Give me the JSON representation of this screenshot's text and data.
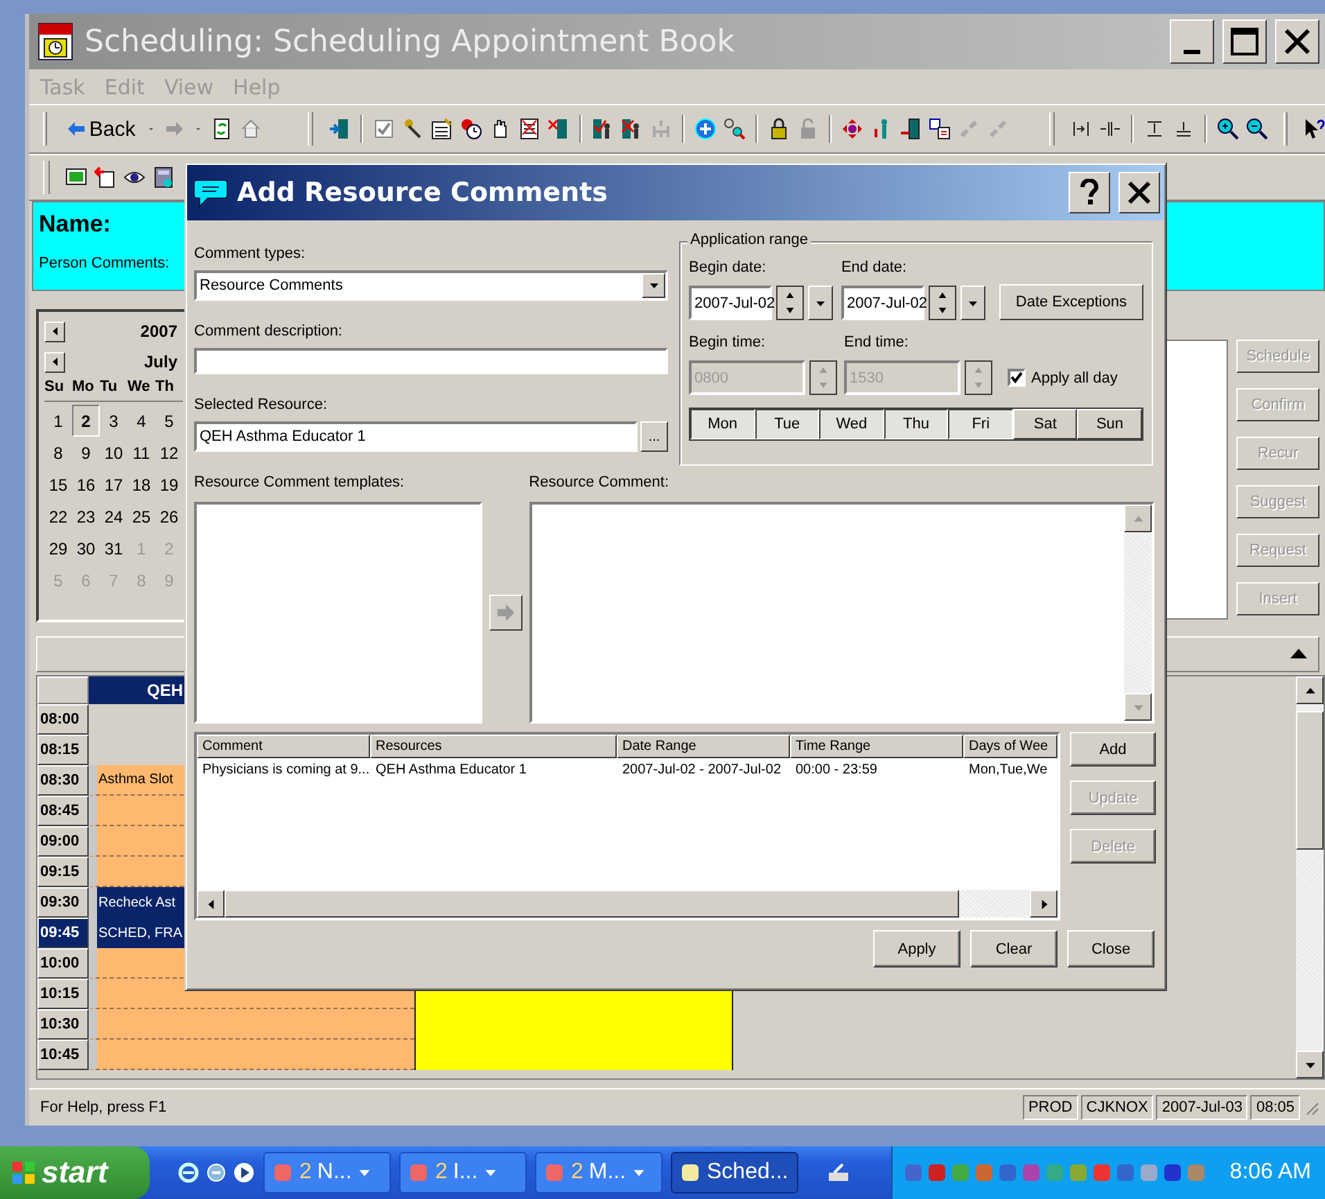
{
  "window": {
    "title": "Scheduling: Scheduling Appointment Book"
  },
  "menu": [
    {
      "label": "Task"
    },
    {
      "label": "Edit"
    },
    {
      "label": "View"
    },
    {
      "label": "Help"
    }
  ],
  "toolbar": {
    "back": "Back"
  },
  "person": {
    "name_label": "Name:",
    "comments_label": "Person Comments:"
  },
  "calendar": {
    "year": "2007",
    "month": "July",
    "weekdays": [
      "Su",
      "Mo",
      "Tu",
      "We",
      "Th"
    ],
    "weeks": [
      [
        {
          "day": "1",
          "muted": false,
          "selected": false
        },
        {
          "day": "2",
          "muted": false,
          "selected": true
        },
        {
          "day": "3",
          "muted": false,
          "selected": false
        },
        {
          "day": "4",
          "muted": false,
          "selected": false
        },
        {
          "day": "5",
          "muted": false,
          "selected": false
        }
      ],
      [
        {
          "day": "8",
          "muted": false,
          "selected": false
        },
        {
          "day": "9",
          "muted": false,
          "selected": false
        },
        {
          "day": "10",
          "muted": false,
          "selected": false
        },
        {
          "day": "11",
          "muted": false,
          "selected": false
        },
        {
          "day": "12",
          "muted": false,
          "selected": false
        }
      ],
      [
        {
          "day": "15",
          "muted": false,
          "selected": false
        },
        {
          "day": "16",
          "muted": false,
          "selected": false
        },
        {
          "day": "17",
          "muted": false,
          "selected": false
        },
        {
          "day": "18",
          "muted": false,
          "selected": false
        },
        {
          "day": "19",
          "muted": false,
          "selected": false
        }
      ],
      [
        {
          "day": "22",
          "muted": false,
          "selected": false
        },
        {
          "day": "23",
          "muted": false,
          "selected": false
        },
        {
          "day": "24",
          "muted": false,
          "selected": false
        },
        {
          "day": "25",
          "muted": false,
          "selected": false
        },
        {
          "day": "26",
          "muted": false,
          "selected": false
        }
      ],
      [
        {
          "day": "29",
          "muted": false,
          "selected": false
        },
        {
          "day": "30",
          "muted": false,
          "selected": false
        },
        {
          "day": "31",
          "muted": false,
          "selected": false
        },
        {
          "day": "1",
          "muted": true,
          "selected": false
        },
        {
          "day": "2",
          "muted": true,
          "selected": false
        }
      ],
      [
        {
          "day": "5",
          "muted": true,
          "selected": false
        },
        {
          "day": "6",
          "muted": true,
          "selected": false
        },
        {
          "day": "7",
          "muted": true,
          "selected": false
        },
        {
          "day": "8",
          "muted": true,
          "selected": false
        },
        {
          "day": "9",
          "muted": true,
          "selected": false
        }
      ]
    ]
  },
  "side_buttons": [
    {
      "label": "Schedule",
      "disabled": true
    },
    {
      "label": "Confirm",
      "disabled": true
    },
    {
      "label": "Recur",
      "disabled": true
    },
    {
      "label": "Suggest",
      "disabled": true
    },
    {
      "label": "Request",
      "disabled": true
    },
    {
      "label": "Insert",
      "disabled": true
    }
  ],
  "schedule": {
    "resource": "QEH",
    "rows": [
      {
        "time": "08:00",
        "selected": false,
        "kind": "free"
      },
      {
        "time": "08:15",
        "selected": false,
        "kind": "free"
      },
      {
        "time": "08:30",
        "selected": false,
        "kind": "slot",
        "label": "Asthma Slot"
      },
      {
        "time": "08:45",
        "selected": false,
        "kind": "slot"
      },
      {
        "time": "09:00",
        "selected": false,
        "kind": "slot"
      },
      {
        "time": "09:15",
        "selected": false,
        "kind": "slot"
      },
      {
        "time": "09:30",
        "selected": false,
        "kind": "appointment",
        "label": "Recheck Ast"
      },
      {
        "time": "09:45",
        "selected": true,
        "kind": "appointment",
        "label": "SCHED, FRA"
      },
      {
        "time": "10:00",
        "selected": false,
        "kind": "slot"
      },
      {
        "time": "10:15",
        "selected": false,
        "kind": "slot",
        "booked": true
      },
      {
        "time": "10:30",
        "selected": false,
        "kind": "slot",
        "booked": true
      },
      {
        "time": "10:45",
        "selected": false,
        "kind": "slot",
        "booked": true
      }
    ]
  },
  "status_bar": {
    "help": "For Help, press F1",
    "panels": [
      "PROD",
      "CJKNOX",
      "2007-Jul-03",
      "08:05"
    ]
  },
  "taskbar": {
    "start": "start",
    "tasks": [
      {
        "count": "2",
        "label": "N...",
        "selected": false
      },
      {
        "count": "2",
        "label": "I...",
        "selected": false
      },
      {
        "count": "2",
        "label": "M...",
        "selected": false
      },
      {
        "label": "Sched...",
        "selected": true
      }
    ],
    "clock": "8:06 AM"
  },
  "dialog": {
    "title": "Add Resource Comments",
    "comment_types": {
      "label": "Comment types:",
      "value": "Resource Comments"
    },
    "description": {
      "label": "Comment description:"
    },
    "selected_resource": {
      "label": "Selected Resource:",
      "value": "QEH Asthma Educator 1",
      "browse": "..."
    },
    "application_range": {
      "title": "Application range",
      "begin_date": {
        "label": "Begin date:",
        "value": "2007-Jul-02"
      },
      "end_date": {
        "label": "End date:",
        "value": "2007-Jul-02"
      },
      "date_exceptions": "Date Exceptions",
      "begin_time": {
        "label": "Begin time:",
        "value": "0800",
        "disabled": true
      },
      "end_time": {
        "label": "End time:",
        "value": "1530",
        "disabled": true
      },
      "apply_all_day": {
        "label": "Apply all day",
        "checked": true
      },
      "days": [
        {
          "label": "Mon",
          "selected": true
        },
        {
          "label": "Tue",
          "selected": true
        },
        {
          "label": "Wed",
          "selected": true
        },
        {
          "label": "Thu",
          "selected": true
        },
        {
          "label": "Fri",
          "selected": true
        },
        {
          "label": "Sat",
          "selected": false
        },
        {
          "label": "Sun",
          "selected": false
        }
      ]
    },
    "templates": {
      "label": "Resource Comment templates:"
    },
    "comment": {
      "label": "Resource Comment:"
    },
    "table": {
      "columns": [
        "Comment",
        "Resources",
        "Date Range",
        "Time Range",
        "Days of Wee"
      ],
      "rows": [
        [
          "Physicians is coming at 9...",
          "QEH Asthma Educator 1",
          "2007-Jul-02 - 2007-Jul-02",
          "00:00 - 23:59",
          "Mon,Tue,We"
        ]
      ]
    },
    "list_buttons": [
      {
        "label": "Add",
        "disabled": false
      },
      {
        "label": "Update",
        "disabled": true
      },
      {
        "label": "Delete",
        "disabled": true
      }
    ],
    "buttons": [
      "Apply",
      "Clear",
      "Close"
    ]
  }
}
